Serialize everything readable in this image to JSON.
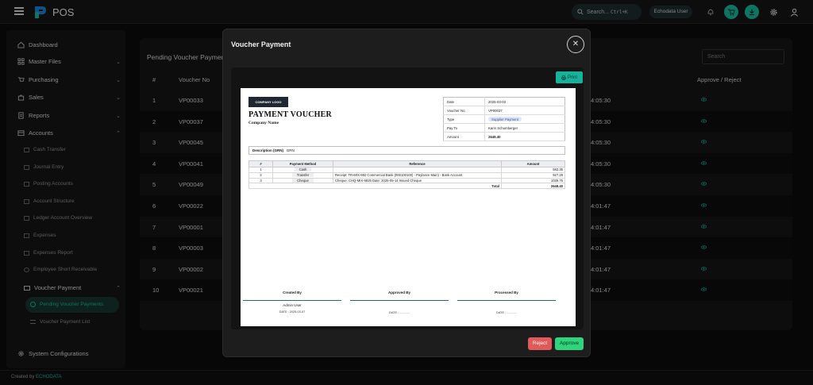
{
  "app": {
    "name": "POS",
    "search_placeholder": "Search...",
    "search_shortcut": "Ctrl+K",
    "user": "Echodata User"
  },
  "sidebar": {
    "items": [
      {
        "label": "Dashboard",
        "icon": "home-icon"
      },
      {
        "label": "Master Files",
        "icon": "grid-icon",
        "expandable": true
      },
      {
        "label": "Purchasing",
        "icon": "cart-icon",
        "expandable": true
      },
      {
        "label": "Sales",
        "icon": "bag-icon",
        "expandable": true
      },
      {
        "label": "Reports",
        "icon": "report-icon",
        "expandable": true
      },
      {
        "label": "Accounts",
        "icon": "wallet-icon",
        "expandable": true,
        "expanded": true
      }
    ],
    "accounts_sub": [
      "Cash Transfer",
      "Journal Entry",
      "Posting Accounts",
      "Account Structure",
      "Ledger Account Overview",
      "Expenses",
      "Expenses Report",
      "Employee Short Receivable"
    ],
    "voucher_group": {
      "label": "Voucher Payment",
      "children": [
        "Pending Voucher Payments",
        "Voucher Payment List"
      ]
    },
    "system": "System Configurations"
  },
  "footer": {
    "prefix": "Created by",
    "brand": "ECHODATA"
  },
  "main": {
    "title": "Pending Voucher Payments",
    "search_placeholder": "Search",
    "columns": {
      "index": "#",
      "voucher": "Voucher No",
      "action": "Approve / Reject"
    },
    "rows": [
      {
        "n": "1",
        "voucher": "VP00033",
        "time": "4:05:30"
      },
      {
        "n": "2",
        "voucher": "VP00037",
        "time": "4:05:30"
      },
      {
        "n": "3",
        "voucher": "VP00045",
        "time": "4:05:30"
      },
      {
        "n": "4",
        "voucher": "VP00041",
        "time": "4:05:30"
      },
      {
        "n": "5",
        "voucher": "VP00049",
        "time": "4:05:30"
      },
      {
        "n": "6",
        "voucher": "VP00022",
        "time": "4:01:47"
      },
      {
        "n": "7",
        "voucher": "VP00001",
        "time": "4:01:47"
      },
      {
        "n": "8",
        "voucher": "VP00003",
        "time": "4:01:47"
      },
      {
        "n": "9",
        "voucher": "VP00002",
        "time": "4:01:47"
      },
      {
        "n": "10",
        "voucher": "VP00021",
        "time": "4:01:47"
      }
    ]
  },
  "modal": {
    "title": "Voucher Payment",
    "print_label": "Print",
    "reject_label": "Reject",
    "approve_label": "Approve",
    "voucher": {
      "logo_text": "COMPANY LOGO",
      "heading": "PAYMENT VOUCHER",
      "company": "Company Name",
      "meta": [
        {
          "k": "Date",
          "v": "2025-03-03"
        },
        {
          "k": "Voucher No.",
          "v": "VP00037"
        },
        {
          "k": "Type",
          "v": "Supplier Payment"
        },
        {
          "k": "Pay To",
          "v": "Karin Schumberger"
        },
        {
          "k": "Amount",
          "v": "2649.40"
        }
      ],
      "description_label": "Description (GRN)",
      "description_value": "GRN",
      "table_headers": [
        "#",
        "Payment Method",
        "Reference",
        "Amount"
      ],
      "lines": [
        {
          "n": "1",
          "method": "Cash",
          "ref": "",
          "amount": "582.35"
        },
        {
          "n": "2",
          "method": "Transfer",
          "ref": "Receipt: TR-MIX-992   Commercial Bank (000100100) - Paylance Main) - Bank Account",
          "amount": "927.29"
        },
        {
          "n": "3",
          "method": "Cheque",
          "ref": "Cheque: CHQ-MIX-9925   Date: 2025-05-14   Issued Cheque",
          "amount": "1039.76"
        }
      ],
      "total_label": "Total",
      "total_value": "2649.40",
      "signatures": [
        {
          "label": "Created By",
          "name": "Admin User",
          "date": "DATE : 2025-03-07"
        },
        {
          "label": "Approved By",
          "name": "",
          "date": "DATE : ............"
        },
        {
          "label": "Processed By",
          "name": "",
          "date": "DATE : ............"
        }
      ]
    }
  },
  "colors": {
    "accent": "#16b39a",
    "reject": "#e05a5a",
    "approve": "#2fd57c"
  }
}
